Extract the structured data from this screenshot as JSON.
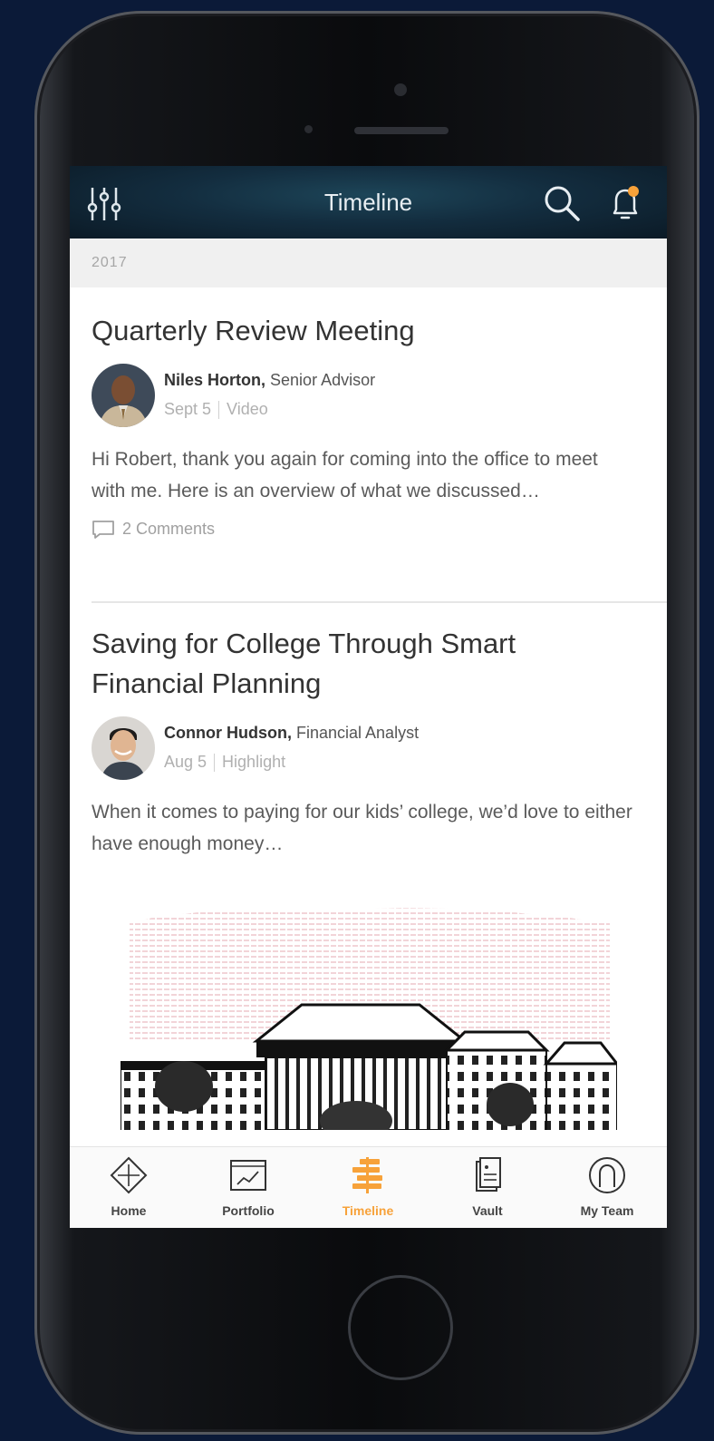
{
  "header": {
    "title": "Timeline"
  },
  "year": "2017",
  "posts": [
    {
      "title": "Quarterly Review Meeting",
      "author": "Niles Horton,",
      "role": "Senior Advisor",
      "date": "Sept 5",
      "type": "Video",
      "excerpt": "Hi Robert, thank you again for coming into the office to meet with me.  Here is an overview of what we discussed…",
      "comments": "2 Comments"
    },
    {
      "title": "Saving for College Through Smart Financial Planning",
      "author": "Connor Hudson,",
      "role": "Financial Analyst",
      "date": "Aug 5",
      "type": "Highlight",
      "excerpt": "When it comes to paying for our kids’ college, we’d love to either have enough money…"
    }
  ],
  "tabs": [
    {
      "label": "Home",
      "icon": "home-diamond-icon"
    },
    {
      "label": "Portfolio",
      "icon": "portfolio-chart-icon"
    },
    {
      "label": "Timeline",
      "icon": "timeline-icon",
      "active": true
    },
    {
      "label": "Vault",
      "icon": "vault-document-icon"
    },
    {
      "label": "My Team",
      "icon": "my-team-icon"
    }
  ],
  "colors": {
    "accent": "#f7a23a",
    "header_bg": "#132d3f",
    "page_bg": "#0b1a38",
    "notification_dot": "#f7a23a"
  }
}
